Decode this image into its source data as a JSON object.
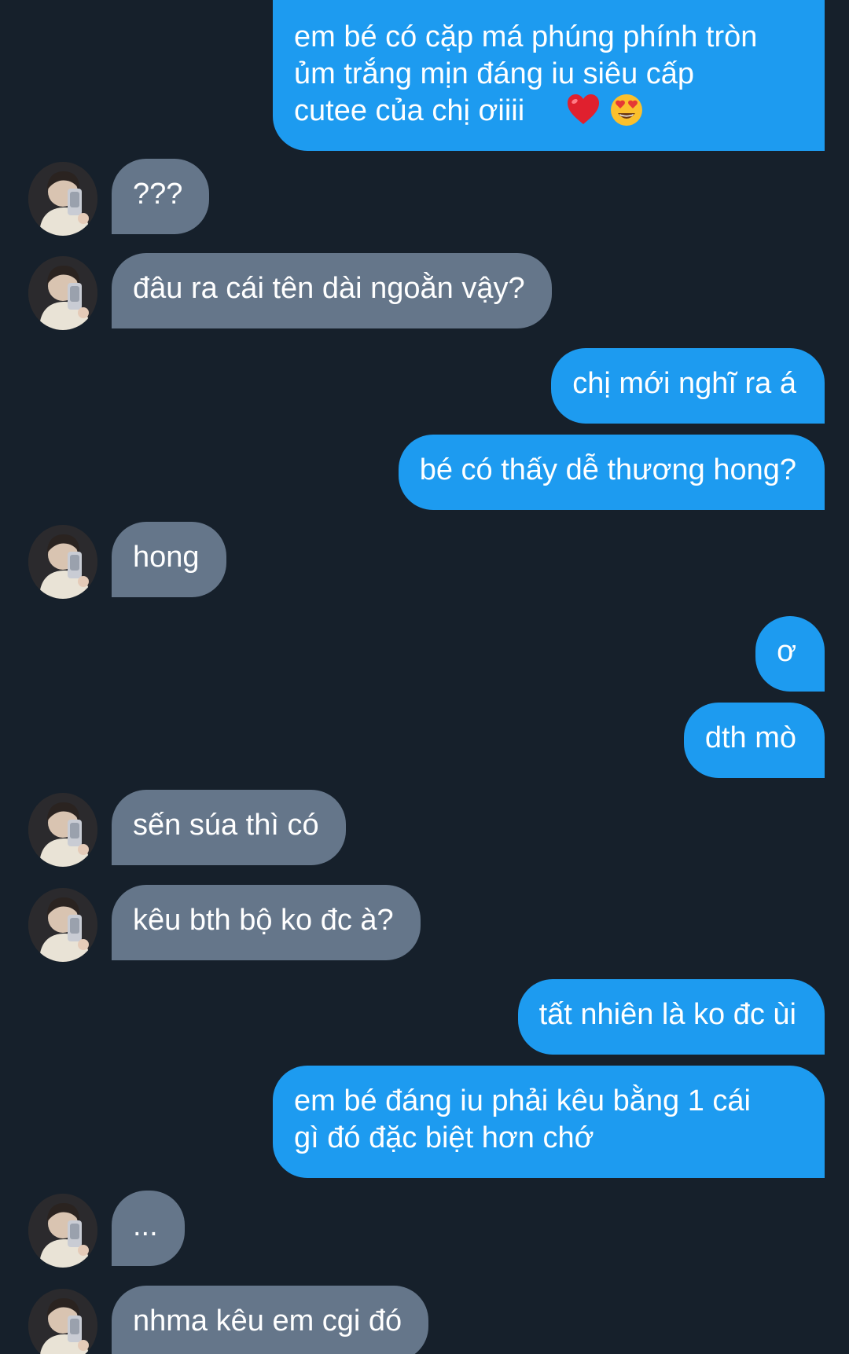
{
  "messages": [
    {
      "dir": "sent",
      "text": "em bé có cặp má phúng phính tròn\nủm trắng mịn đáng iu siêu cấp\ncutee của chị ơiiii",
      "emojis": [
        "red-heart-icon",
        "heart-eyes-face-icon"
      ]
    },
    {
      "dir": "recv",
      "text": "???"
    },
    {
      "dir": "recv",
      "text": "đâu ra cái tên dài ngoằn vậy?"
    },
    {
      "dir": "sent",
      "text": "chị mới nghĩ ra á"
    },
    {
      "dir": "sent",
      "text": "bé có thấy dễ thương hong?"
    },
    {
      "dir": "recv",
      "text": "hong"
    },
    {
      "dir": "sent",
      "text": "ơ"
    },
    {
      "dir": "sent",
      "text": "dth mò"
    },
    {
      "dir": "recv",
      "text": "sến súa thì có"
    },
    {
      "dir": "recv",
      "text": "kêu bth bộ ko đc à?"
    },
    {
      "dir": "sent",
      "text": "tất nhiên là ko đc ùi"
    },
    {
      "dir": "sent",
      "text": "em bé đáng iu phải kêu bằng 1 cái\ngì đó đặc biệt hơn chớ"
    },
    {
      "dir": "recv",
      "text": "..."
    },
    {
      "dir": "recv",
      "text": "nhma kêu em cgi đó"
    }
  ],
  "colors": {
    "background": "#16202b",
    "sent_bubble": "#1d9bf0",
    "received_bubble": "#65768a",
    "text": "#ffffff"
  }
}
